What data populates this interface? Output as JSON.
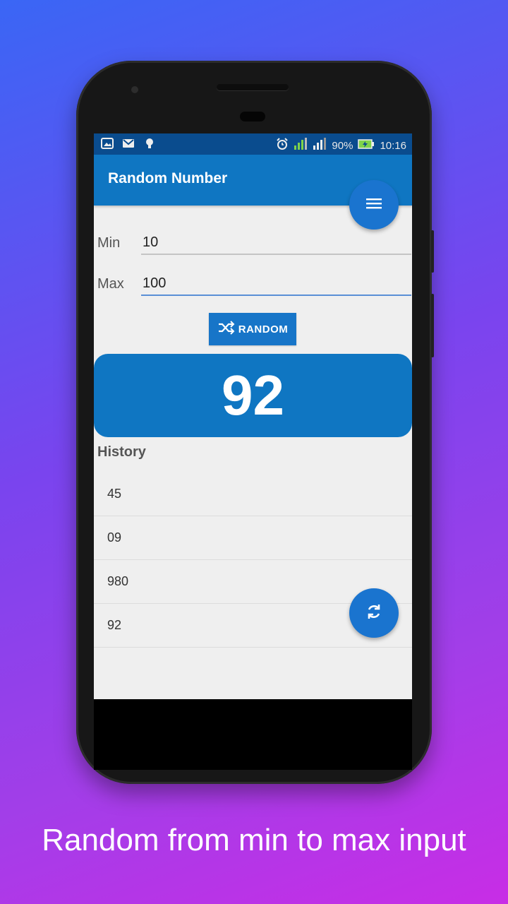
{
  "status_bar": {
    "battery_percent": "90%",
    "time": "10:16"
  },
  "app": {
    "title": "Random Number"
  },
  "form": {
    "min_label": "Min",
    "min_value": "10",
    "max_label": "Max",
    "max_value": "100",
    "random_button_label": "RANDOM"
  },
  "result": {
    "value": "92"
  },
  "history": {
    "title": "History",
    "items": [
      "45",
      "09",
      "980",
      "92"
    ]
  },
  "caption": "Random from min to max input",
  "colors": {
    "primary": "#0f76c2",
    "status_bar": "#0a4c8e",
    "fab": "#1a74cf"
  },
  "icons": {
    "menu_fab": "hamburger-menu-icon",
    "refresh_fab": "refresh-icon",
    "random_button": "shuffle-icon"
  }
}
